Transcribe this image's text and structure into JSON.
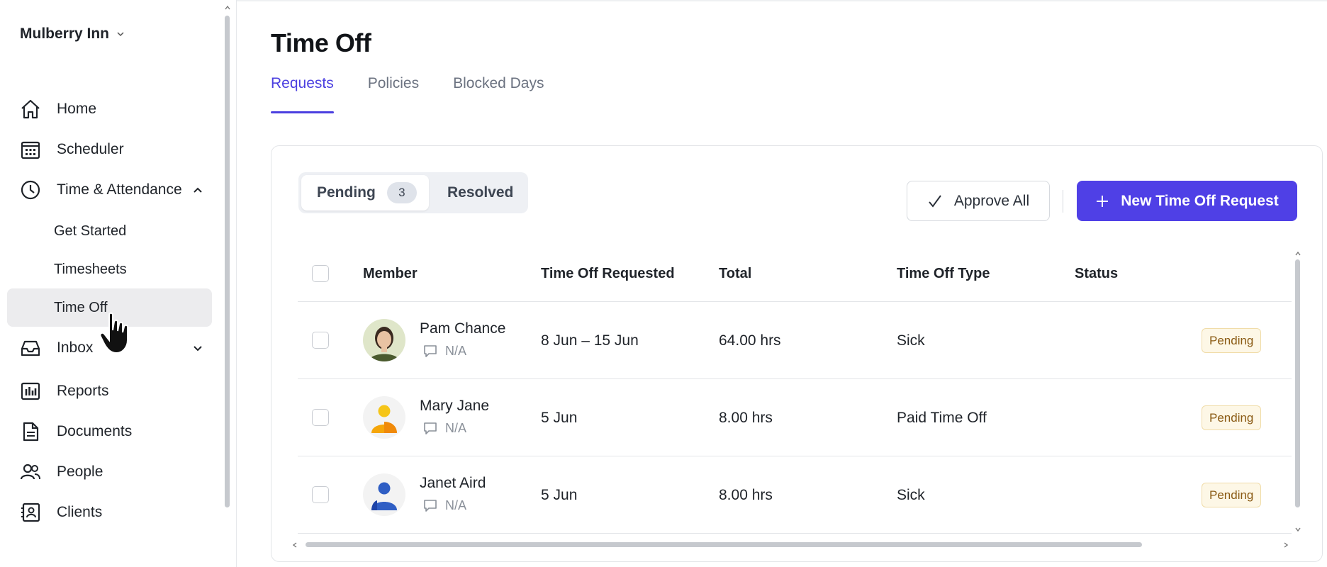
{
  "sidebar": {
    "org_name": "Mulberry Inn",
    "items": [
      {
        "label": "Home",
        "icon": "home-icon"
      },
      {
        "label": "Scheduler",
        "icon": "calendar-icon"
      },
      {
        "label": "Time & Attendance",
        "icon": "clock-icon",
        "expanded": true
      },
      {
        "label": "Inbox",
        "icon": "inbox-icon"
      },
      {
        "label": "Reports",
        "icon": "bar-chart-icon"
      },
      {
        "label": "Documents",
        "icon": "document-icon"
      },
      {
        "label": "People",
        "icon": "people-icon"
      },
      {
        "label": "Clients",
        "icon": "contact-card-icon"
      }
    ],
    "sub_items": [
      {
        "label": "Get Started"
      },
      {
        "label": "Timesheets"
      },
      {
        "label": "Time Off",
        "active": true
      }
    ]
  },
  "page": {
    "title": "Time Off",
    "tabs": [
      {
        "label": "Requests",
        "active": true
      },
      {
        "label": "Policies"
      },
      {
        "label": "Blocked Days"
      }
    ]
  },
  "filters": {
    "pending_label": "Pending",
    "pending_count": "3",
    "resolved_label": "Resolved"
  },
  "actions": {
    "approve_all": "Approve All",
    "new_request": "New Time Off Request"
  },
  "table": {
    "columns": [
      "Member",
      "Time Off Requested",
      "Total",
      "Time Off Type",
      "Status"
    ],
    "rows": [
      {
        "name": "Pam Chance",
        "note": "N/A",
        "requested": "8 Jun – 15 Jun",
        "total": "64.00 hrs",
        "type": "Sick",
        "status": "Pending"
      },
      {
        "name": "Mary Jane",
        "note": "N/A",
        "requested": "5 Jun",
        "total": "8.00 hrs",
        "type": "Paid Time Off",
        "status": "Pending"
      },
      {
        "name": "Janet Aird",
        "note": "N/A",
        "requested": "5 Jun",
        "total": "8.00 hrs",
        "type": "Sick",
        "status": "Pending"
      }
    ]
  },
  "colors": {
    "accent": "#4f40e6",
    "status_pending_bg": "#fdf7e6",
    "status_pending_text": "#8a5a13"
  }
}
